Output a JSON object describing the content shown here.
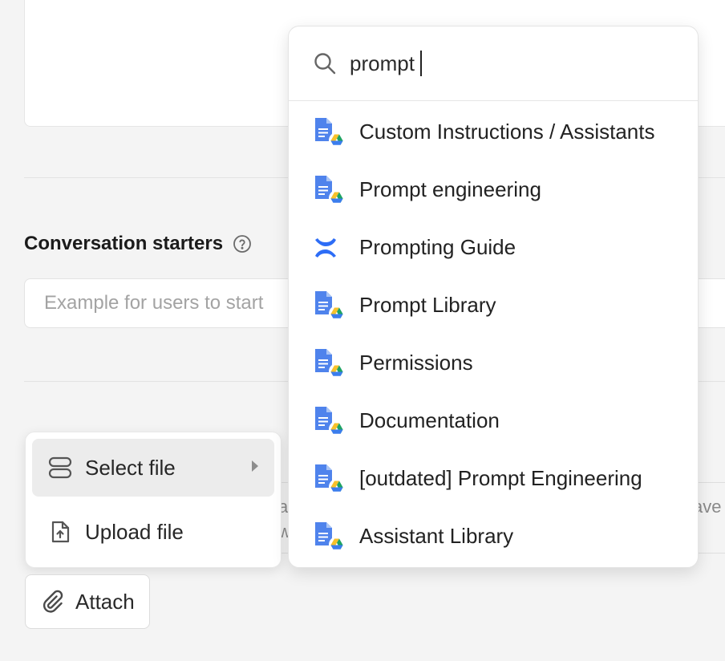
{
  "conversation_starters": {
    "title": "Conversation starters",
    "placeholder": "Example for users to start"
  },
  "background_fragments": {
    "line1_left": "a",
    "line1_right": "ave",
    "line2_left": "w"
  },
  "attach_menu": {
    "items": [
      {
        "label": "Select file",
        "icon": "stack-icon"
      },
      {
        "label": "Upload file",
        "icon": "file-upload-icon"
      }
    ]
  },
  "attach_button": {
    "label": "Attach",
    "icon": "paperclip-icon"
  },
  "search": {
    "value": "prompt",
    "icon": "search-icon",
    "results": [
      {
        "label": "Custom Instructions / Assistants",
        "source": "google-drive"
      },
      {
        "label": "Prompt engineering",
        "source": "google-drive"
      },
      {
        "label": "Prompting Guide",
        "source": "confluence"
      },
      {
        "label": "Prompt Library",
        "source": "google-drive"
      },
      {
        "label": "Permissions",
        "source": "google-drive"
      },
      {
        "label": "Documentation",
        "source": "google-drive"
      },
      {
        "label": "[outdated] Prompt Engineering",
        "source": "google-drive"
      },
      {
        "label": "Assistant Library",
        "source": "google-drive"
      }
    ]
  },
  "colors": {
    "doc_blue": "#4f83ec",
    "confluence_blue": "#2d6df6",
    "drive_green": "#1ea362",
    "drive_yellow": "#f7c12b",
    "drive_blue": "#3b7ded"
  }
}
